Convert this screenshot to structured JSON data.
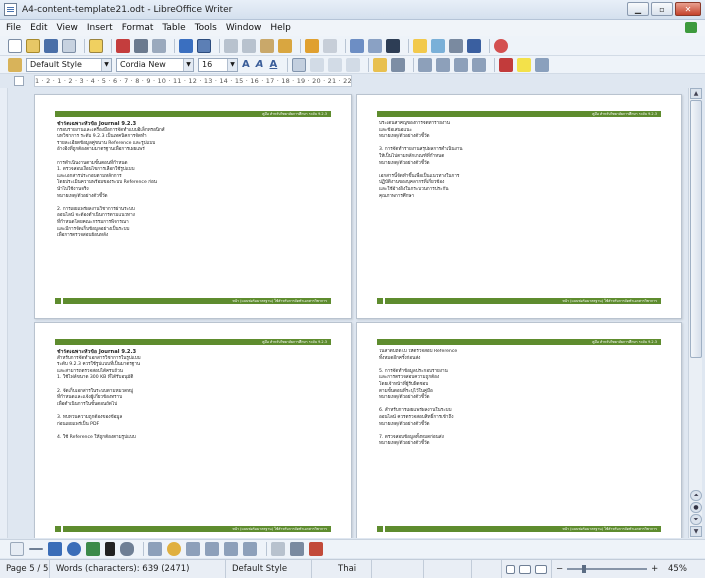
{
  "window": {
    "title": "A4-content-template21.odt - LibreOffice Writer",
    "controls": [
      "minimize-icon",
      "restore-icon",
      "close-icon"
    ]
  },
  "menu": [
    "File",
    "Edit",
    "View",
    "Insert",
    "Format",
    "Table",
    "Tools",
    "Window",
    "Help"
  ],
  "formatting": {
    "paragraph_style": "Default Style",
    "font_name": "Cordia New",
    "font_size": "16"
  },
  "ruler": {
    "ticks": "1 · 2 · 1 · 2 · 3 · 4 · 5 · 6 · 7 · 8 · 9 · 10 · 11 · 12 · 13 · 14 · 15 · 16 · 17 · 18 · 19 · 20 · 21 · 22 · 23 · 24 · 25 · 26 · 27"
  },
  "pages": [
    {
      "title": "ชำร์ตเฉพาะหัวข้อ Journal 9.2.3",
      "body": "กรอบรายงานและเครื่องมือการจัดทำแบบอิเล็กทรอนิกส์\nบทวิชาการ ระดับ 9.2.3 เป็นเทคนิคการจัดทำ\nรายละเอียดข้อมูลคู่ขนาน Reference และรูปแบบ\nอ้างอิงที่ถูกต้องตามมาตรฐานเพื่อการเผยแพร่\n\nการดำเนินงานตามขั้นตอนที่กำหนด\n1. ตรวจสอบเงื่อนไขการเลือกใช้รูปแบบ\nและเอกสารประกอบตามหลักการ\nโดยประเมินความพร้อมของระบบ Reference ก่อน\nนำไปใช้งานจริง\nหมายเหตุ/ตัวอย่างตัวชี้วัด\n\n2. การเผยแพร่ผลงานวิชาการผ่านระบบ\nออนไลน์ จะต้องดำเนินการตามแนวทาง\nที่กำหนดโดยคณะกรรมการพิจารณา\nและมีการจัดเก็บข้อมูลอย่างเป็นระบบ\nเพื่อการตรวจสอบย้อนหลัง",
      "header": "คู่มือ สำหรับวิทยาลัยการศึกษา ระดับ 9.2.3",
      "footer": "หน้า (แบบฟอร์มมาตรฐาน) ใช้สำหรับการจัดทำเอกสารวิชาการ"
    },
    {
      "title": "",
      "body": "ประเด็นสำคัญของการจัดทำรายงาน\nและข้อเสนอแนะ\nหมายเหตุ/ตัวอย่างตัวชี้วัด\n\n3. การจัดทำรายงานสรุปผลการดำเนินงาน\nให้เป็นไปตามหลักเกณฑ์ที่กำหนด\nหมายเหตุ/ตัวอย่างตัวชี้วัด\n\nเอกสารนี้จัดทำขึ้นเพื่อเป็นแนวทางในการ\nปฏิบัติงานของบุคลากรที่เกี่ยวข้อง\nและใช้อ้างอิงในกระบวนการประกัน\nคุณภาพการศึกษา",
      "header": "คู่มือ สำหรับวิทยาลัยการศึกษา ระดับ 9.2.3",
      "footer": "หน้า (แบบฟอร์มมาตรฐาน) ใช้สำหรับการจัดทำเอกสารวิชาการ"
    },
    {
      "title": "ชำร์ตเฉพาะหัวข้อ Journal 9.2.3",
      "body": "สำหรับการจัดทำเอกสารวิชาการในรูปแบบ\nระดับ 9.2.3 ควรใช้รูปแบบที่เป็นมาตรฐาน\nและสามารถตรวจสอบได้ครบถ้วน\n1. ใช้ไฟล์ขนาด 300 KB ที่ได้รับอนุมัติ\n\n2. จัดเก็บเอกสารในระบบตามหมวดหมู่\nที่กำหนดและแจ้งผู้เกี่ยวข้องทราบ\nเพื่อดำเนินการในขั้นตอนถัดไป\n\n3. ทบทวนความถูกต้องของข้อมูล\nก่อนเผยแพร่เป็น PDF\n\n4. ใช้ Reference ให้ถูกต้องตามรูปแบบ",
      "header": "คู่มือ สำหรับวิทยาลัยการศึกษา ระดับ 9.2.3",
      "footer": "หน้า (แบบฟอร์มมาตรฐาน) ใช้สำหรับการจัดทำเอกสารวิชาการ"
    },
    {
      "title": "",
      "body": "ในลำดับถัดไป ให้ตรวจสอบ Reference\nทั้งหมดอีกครั้งก่อนส่ง\n\n5. การจัดทำข้อมูลประกอบรายงาน\nและการตรวจสอบความถูกต้อง\nโดยเจ้าหน้าที่ผู้รับผิดชอบ\nตามขั้นตอนที่ระบุไว้ในคู่มือ\nหมายเหตุ/ตัวอย่างตัวชี้วัด\n\n6. สำหรับการเผยแพร่ผลงานในระบบ\nออนไลน์ ควรตรวจสอบสิทธิ์การเข้าถึง\nหมายเหตุ/ตัวอย่างตัวชี้วัด\n\n7. ตรวจสอบข้อมูลทั้งหมดก่อนส่ง\nหมายเหตุ/ตัวอย่างตัวชี้วัด",
      "header": "คู่มือ สำหรับวิทยาลัยการศึกษา ระดับ 9.2.3",
      "footer": "หน้า (แบบฟอร์มมาตรฐาน) ใช้สำหรับการจัดทำเอกสารวิชาการ"
    }
  ],
  "status": {
    "page": "Page 5 / 5",
    "words": "Words (characters): 639 (2471)",
    "style": "Default Style",
    "language": "Thai",
    "zoom": "45%",
    "zoom_fraction": 0.45
  },
  "colors": {
    "accent_green": "#5e8c2e"
  }
}
